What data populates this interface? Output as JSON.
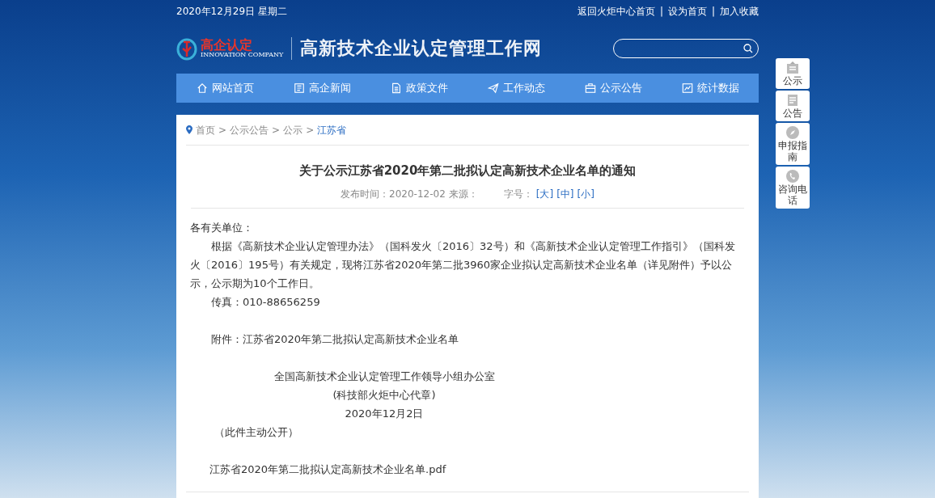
{
  "top_bar": {
    "date": "2020年12月29日 星期二",
    "links": [
      "返回火炬中心首页",
      "设为首页",
      "加入收藏"
    ],
    "separator": "|"
  },
  "header": {
    "logo_text": "高企认定",
    "logo_subtext": "INNOVATION COMPANY",
    "site_title": "高新技术企业认定管理工作网"
  },
  "nav": [
    {
      "label": "网站首页",
      "kind": "home"
    },
    {
      "label": "高企新闻",
      "kind": "news"
    },
    {
      "label": "政策文件",
      "kind": "file"
    },
    {
      "label": "工作动态",
      "kind": "send"
    },
    {
      "label": "公示公告",
      "kind": "bag"
    },
    {
      "label": "统计数据",
      "kind": "chart"
    }
  ],
  "breadcrumb": {
    "items": [
      "首页",
      "公示公告",
      "公示",
      "江苏省"
    ],
    "separator": ">"
  },
  "article": {
    "title": "关于公示江苏省2020年第二批拟认定高新技术企业名单的通知",
    "meta": {
      "date": "发布时间：2020-12-02",
      "source": "来源：",
      "font_size_label": "字号：",
      "font_sizes": [
        "[大]",
        "[中]",
        "[小]"
      ]
    },
    "greeting": "各有关单位：",
    "body": "根据《高新技术企业认定管理办法》（国科发火〔2016〕32号）和《高新技术企业认定管理工作指引》（国科发火〔2016〕195号）有关规定，现将江苏省2020年第二批3960家企业拟认定高新技术企业名单（详见附件）予以公示，公示期为10个工作日。",
    "fax": "传真：010-88656259",
    "attachment_note": "附件：江苏省2020年第二批拟认定高新技术企业名单",
    "signature": [
      "全国高新技术企业认定管理工作领导小组办公室",
      "(科技部火炬中心代章)",
      "2020年12月2日"
    ],
    "public_note": "（此件主动公开）",
    "attachment_link": "江苏省2020年第二批拟认定高新技术企业名单.pdf"
  },
  "side_buttons": [
    {
      "label": "公示",
      "kind": "board"
    },
    {
      "label": "公告",
      "kind": "notepad"
    },
    {
      "label": "申报指南",
      "kind": "compass"
    },
    {
      "label": "咨询电话",
      "kind": "phone"
    }
  ]
}
